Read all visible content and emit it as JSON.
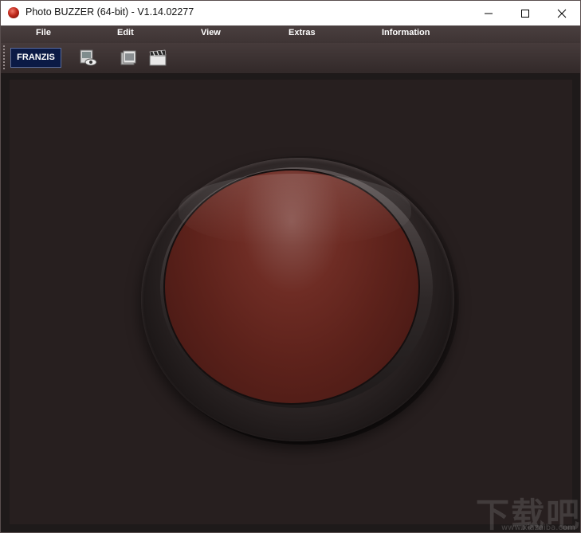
{
  "window": {
    "title": "Photo BUZZER (64-bit) - V1.14.02277",
    "controls": {
      "minimize_icon": "minimize-icon",
      "maximize_icon": "maximize-icon",
      "close_icon": "close-icon"
    }
  },
  "menu": {
    "items": [
      {
        "label": "File"
      },
      {
        "label": "Edit"
      },
      {
        "label": "View"
      },
      {
        "label": "Extras"
      },
      {
        "label": "Information"
      }
    ]
  },
  "toolbar": {
    "brand_label": "FRANZIS",
    "buttons": [
      {
        "icon": "image-view-icon"
      },
      {
        "icon": "folder-image-icon"
      },
      {
        "icon": "clapperboard-icon"
      }
    ]
  },
  "main": {
    "buzzer_color": "#5d221b"
  },
  "watermark": {
    "text": "下载吧",
    "subtext": "www.xiazaiba.com"
  }
}
